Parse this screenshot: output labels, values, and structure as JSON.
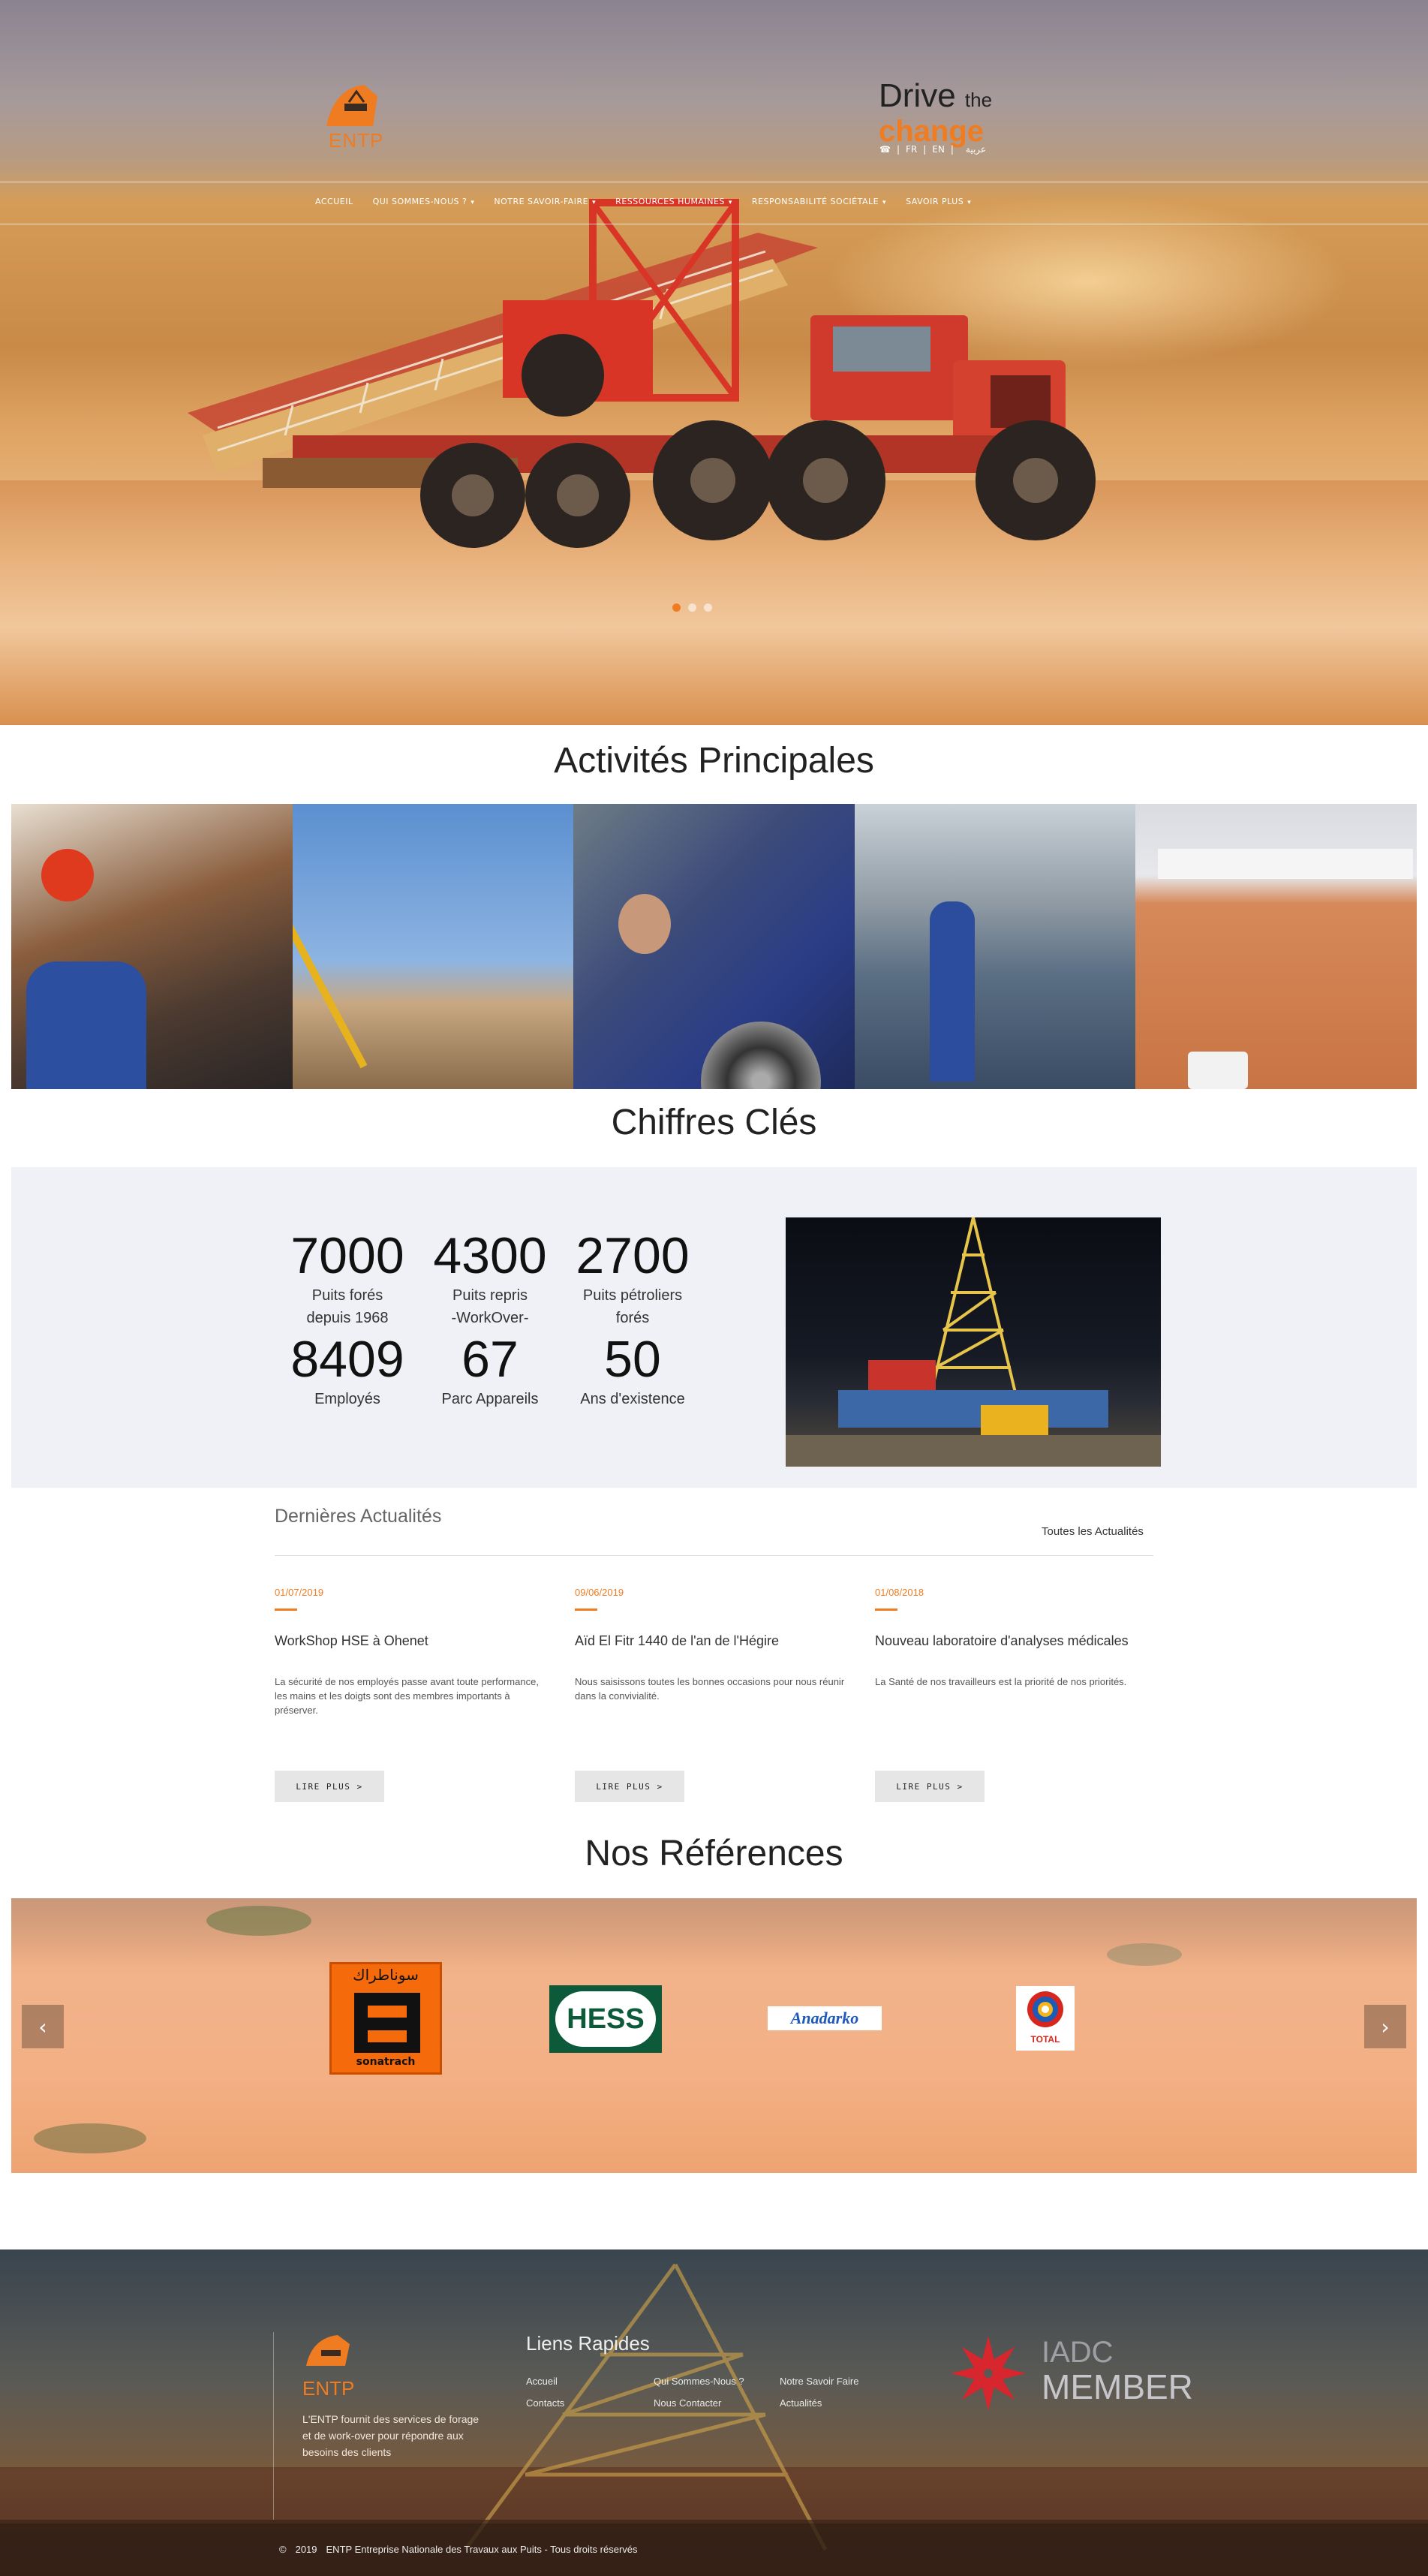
{
  "header": {
    "logo_text": "ENTP",
    "slogan_line1_main": "Drive",
    "slogan_line1_small": "the",
    "slogan_line2": "change",
    "languages": [
      "FR",
      "EN",
      "عربية"
    ],
    "phone_icon": "phone-icon"
  },
  "nav": {
    "items": [
      {
        "label": "ACCUEIL",
        "has_dropdown": false
      },
      {
        "label": "QUI SOMMES-NOUS ?",
        "has_dropdown": true
      },
      {
        "label": "NOTRE SAVOIR-FAIRE",
        "has_dropdown": true
      },
      {
        "label": "RESSOURCES HUMAINES",
        "has_dropdown": true
      },
      {
        "label": "RESPONSABILITÉ SOCIÉTALE",
        "has_dropdown": true
      },
      {
        "label": "SAVOIR PLUS",
        "has_dropdown": true
      }
    ]
  },
  "activities": {
    "title": "Activités Principales"
  },
  "key_figures": {
    "title": "Chiffres Clés",
    "stats": [
      {
        "value": "7000",
        "label_l1": "Puits forés",
        "label_l2": "depuis 1968"
      },
      {
        "value": "4300",
        "label_l1": "Puits repris",
        "label_l2": "-WorkOver-"
      },
      {
        "value": "2700",
        "label_l1": "Puits pétroliers",
        "label_l2": "forés"
      },
      {
        "value": "8409",
        "label_l1": "Employés",
        "label_l2": ""
      },
      {
        "value": "67",
        "label_l1": "Parc Appareils",
        "label_l2": ""
      },
      {
        "value": "50",
        "label_l1": "Ans d'existence",
        "label_l2": ""
      }
    ]
  },
  "news": {
    "title": "Dernières Actualités",
    "all_link": "Toutes les Actualités",
    "items": [
      {
        "date": "01/07/2019",
        "title": "WorkShop HSE à Ohenet",
        "text": "La sécurité de nos employés passe avant toute performance, les mains et les doigts sont des membres importants à préserver.",
        "button": "LIRE PLUS >"
      },
      {
        "date": "09/06/2019",
        "title": "Aïd El Fitr 1440 de l'an de l'Hégire",
        "text": "Nous saisissons toutes les bonnes occasions pour nous réunir dans la convivialité.",
        "button": "LIRE PLUS >"
      },
      {
        "date": "01/08/2018",
        "title": "Nouveau laboratoire d'analyses médicales",
        "text": "La Santé de nos travailleurs est la priorité de nos priorités.",
        "button": "LIRE PLUS >"
      }
    ]
  },
  "references": {
    "title": "Nos Références",
    "logos": [
      {
        "name": "sonatrach",
        "text_top": "سوناطراك",
        "text_bottom": "sonatrach",
        "color": "#f56a0a"
      },
      {
        "name": "hess",
        "text": "HESS",
        "color": "#0c5a3a"
      },
      {
        "name": "anadarko",
        "text": "Anadarko",
        "color": "#1e59b9"
      },
      {
        "name": "total",
        "text": "TOTAL",
        "color": "#d7261e"
      }
    ],
    "prev": "‹",
    "next": "›"
  },
  "footer": {
    "logo_text": "ENTP",
    "description": "L'ENTP fournit des services de forage et de work-over pour répondre aux besoins des clients",
    "links_title": "Liens Rapides",
    "links": [
      "Accueil",
      "Qui Sommes-Nous ?",
      "Notre Savoir Faire",
      "Contacts",
      "Nous Contacter",
      "Actualités"
    ],
    "iadc_top": "IADC",
    "iadc_bottom": "MEMBER",
    "copyright_year": "2019",
    "copyright_text": "ENTP Entreprise Nationale des Travaux aux Puits - Tous droits réservés",
    "copyright_icon": "copyright-icon"
  },
  "colors": {
    "accent": "#f07c22",
    "stats_bg": "#f0f1f6",
    "button_bg": "#e6e6e6"
  }
}
